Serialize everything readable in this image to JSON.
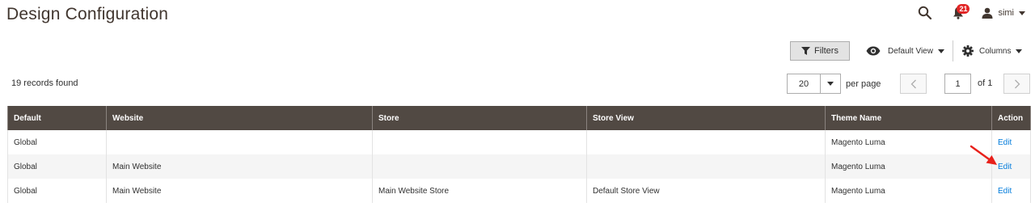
{
  "header": {
    "title": "Design Configuration",
    "notifications_count": "21",
    "user_name": "simi"
  },
  "toolbar": {
    "filters_label": "Filters",
    "view_label": "Default View",
    "columns_label": "Columns"
  },
  "records_found": "19 records found",
  "pager": {
    "per_page_value": "20",
    "per_page_label": "per page",
    "current_page": "1",
    "of_pages": "of 1"
  },
  "grid": {
    "columns": [
      "Default",
      "Website",
      "Store",
      "Store View",
      "Theme Name",
      "Action"
    ],
    "rows": [
      [
        "Global",
        "",
        "",
        "",
        "Magento Luma",
        "Edit"
      ],
      [
        "Global",
        "Main Website",
        "",
        "",
        "Magento Luma",
        "Edit"
      ],
      [
        "Global",
        "Main Website",
        "Main Website Store",
        "Default Store View",
        "Magento Luma",
        "Edit"
      ]
    ]
  },
  "colors": {
    "header_bg": "#514943",
    "link": "#007bdb",
    "badge": "#e22626",
    "annotation_arrow": "#e8201a"
  }
}
